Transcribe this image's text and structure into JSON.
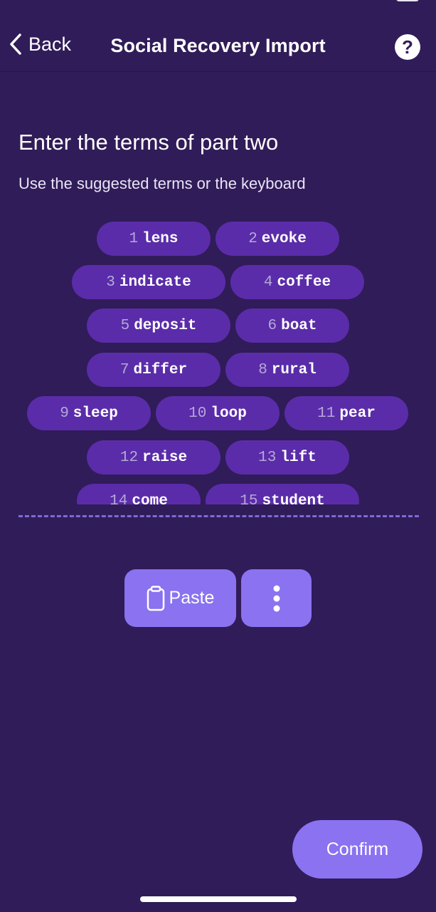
{
  "nav": {
    "back_label": "Back",
    "title": "Social Recovery Import",
    "help_label": "?"
  },
  "content": {
    "heading": "Enter the terms of part two",
    "subheading": "Use the suggested terms or the keyboard"
  },
  "words": [
    {
      "num": "1",
      "word": "lens"
    },
    {
      "num": "2",
      "word": "evoke"
    },
    {
      "num": "3",
      "word": "indicate"
    },
    {
      "num": "4",
      "word": "coffee"
    },
    {
      "num": "5",
      "word": "deposit"
    },
    {
      "num": "6",
      "word": "boat"
    },
    {
      "num": "7",
      "word": "differ"
    },
    {
      "num": "8",
      "word": "rural"
    },
    {
      "num": "9",
      "word": "sleep"
    },
    {
      "num": "10",
      "word": "loop"
    },
    {
      "num": "11",
      "word": "pear"
    },
    {
      "num": "12",
      "word": "raise"
    },
    {
      "num": "13",
      "word": "lift"
    },
    {
      "num": "14",
      "word": "come"
    },
    {
      "num": "15",
      "word": "student"
    }
  ],
  "actions": {
    "paste_label": "Paste",
    "more_icon": "vertical-dots-icon",
    "clipboard_icon": "clipboard-icon",
    "confirm_label": "Confirm"
  },
  "colors": {
    "background": "#301c58",
    "pill": "#5a2ca9",
    "button": "#8a72f0",
    "divider": "#7b6bd8"
  }
}
